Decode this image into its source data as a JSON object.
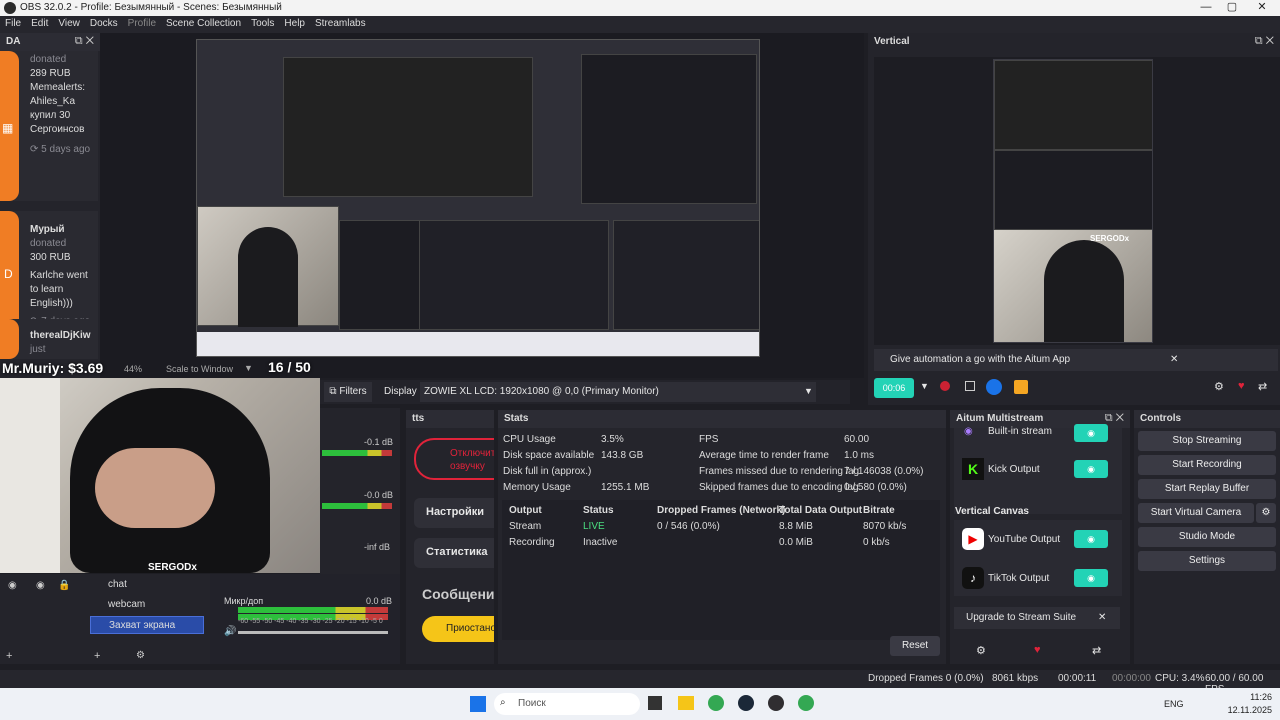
{
  "window": {
    "title": "OBS 32.0.2 - Profile: Безымянный - Scenes: Безымянный",
    "controls": [
      "—",
      "▢",
      "✕"
    ]
  },
  "menu": [
    "File",
    "Edit",
    "View",
    "Docks",
    "Profile",
    "Scene Collection",
    "Tools",
    "Help",
    "Streamlabs"
  ],
  "chat_dock": {
    "title": "DA",
    "items": [
      {
        "lines": [
          "donated",
          "289 RUB",
          "",
          "Memealerts:",
          "Ahiles_Ka",
          "купил 30",
          "Сергоинсов"
        ],
        "time": "5 days ago"
      },
      {
        "name": "Мурый",
        "donated": "donated",
        "amount": "300 RUB",
        "msg": [
          "Karlche went",
          "to learn",
          "English)))"
        ],
        "time": "7 days ago"
      },
      {
        "name": "therealDjKiw",
        "time": "just"
      }
    ]
  },
  "preview": {
    "overlay_left": "Mr.Muriy: $3.69",
    "overlay_counter": "16 / 50",
    "zoom": "44%",
    "scale": "Scale to Window",
    "counter_big": "16 / 50"
  },
  "webcam": {
    "brand": "SERGODx"
  },
  "display": {
    "filters_btn": "Filters",
    "display_label": "Display",
    "display_value": "ZOWIE XL LCD: 1920x1080 @ 0,0 (Primary Monitor)"
  },
  "sources": {
    "items": [
      "chat",
      "webcam",
      "Захват экрана"
    ]
  },
  "mixer": {
    "channels": [
      {
        "db": "-0.1 dB"
      },
      {
        "db": "-0.0 dB"
      },
      {
        "db": "-inf dB"
      },
      {
        "name": "Микр/доп",
        "db": "0.0 dB"
      }
    ],
    "scale": "-60 -55 -50 -45 -40 -35 -30 -25 -20 -15 -10 -5 0"
  },
  "tts": {
    "title": "tts",
    "buttons": [
      "Отключить озвучку",
      "Настройки",
      "Статистика"
    ],
    "section": "Сообщени",
    "pause": "Приостано"
  },
  "stats": {
    "title": "Stats",
    "left": [
      [
        "CPU Usage",
        "3.5%"
      ],
      [
        "Disk space available",
        "143.8 GB"
      ],
      [
        "Disk full in (approx.)",
        ""
      ],
      [
        "Memory Usage",
        "1255.1 MB"
      ]
    ],
    "right": [
      [
        "FPS",
        "60.00"
      ],
      [
        "Average time to render frame",
        "1.0 ms"
      ],
      [
        "Frames missed due to rendering lag",
        "7 / 146038 (0.0%)"
      ],
      [
        "Skipped frames due to encoding lag",
        "0 / 580 (0.0%)"
      ]
    ],
    "headers": [
      "Output",
      "Status",
      "Dropped Frames (Network)",
      "Total Data Output",
      "Bitrate"
    ],
    "rows": [
      [
        "Stream",
        "LIVE",
        "0 / 546 (0.0%)",
        "8.8 MiB",
        "8070 kb/s"
      ],
      [
        "Recording",
        "Inactive",
        "",
        "0.0 MiB",
        "0 kb/s"
      ]
    ],
    "reset": "Reset"
  },
  "vertical": {
    "title": "Vertical",
    "banner": "Give automation a go with the Aitum App",
    "timer": "00:06",
    "brand": "SERGODx"
  },
  "multistream": {
    "title": "Aitum Multistream",
    "outputs": [
      "Built-in stream",
      "Kick Output"
    ],
    "vertical_label": "Vertical Canvas",
    "vertical_outputs": [
      "YouTube Output",
      "TikTok Output"
    ],
    "upgrade": "Upgrade to Stream Suite"
  },
  "controls": {
    "title": "Controls",
    "buttons": [
      "Stop Streaming",
      "Start Recording",
      "Start Replay Buffer",
      "Start Virtual Camera",
      "Studio Mode",
      "Settings"
    ]
  },
  "statusbar": {
    "dropped": "Dropped Frames 0 (0.0%)",
    "kbps": "8061 kbps",
    "live_time": "00:00:11",
    "rec_time": "00:00:00",
    "cpu": "CPU: 3.4%",
    "fps": "60.00 / 60.00 FPS"
  },
  "taskbar": {
    "search": "Поиск",
    "lang": "ENG",
    "time": "11:26",
    "date": "12.11.2025"
  }
}
